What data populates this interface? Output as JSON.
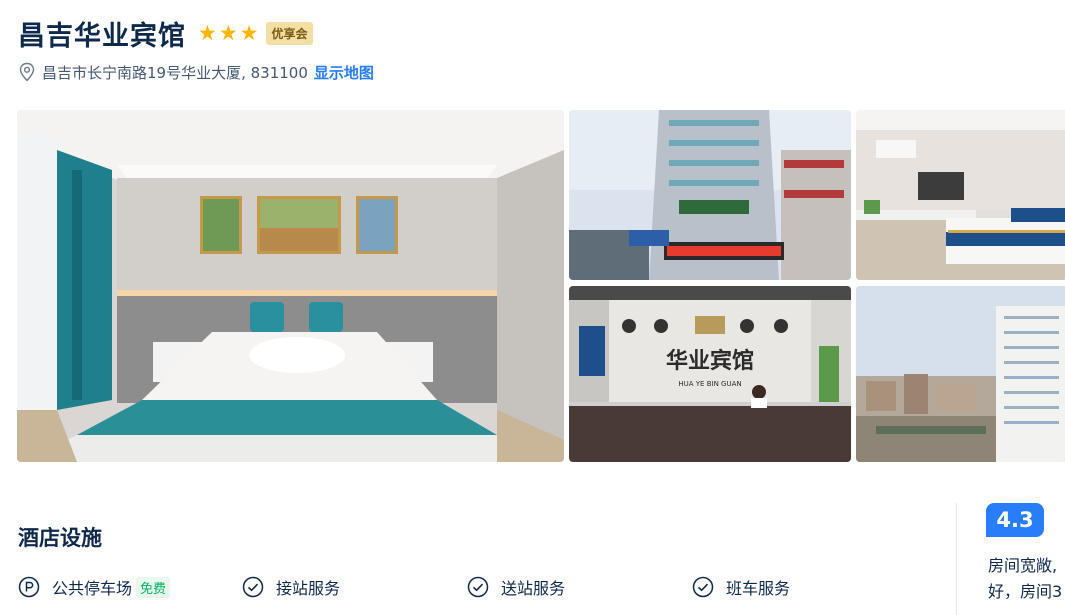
{
  "hotel": {
    "name": "昌吉华业宾馆",
    "star_count": 3,
    "badge": "优享会",
    "address": "昌吉市长宁南路19号华业大厦, 831100",
    "map_link": "显示地图"
  },
  "gallery": {
    "lobby_sign": "华业宾馆",
    "lobby_sign_pinyin": "HUA YE BIN GUAN"
  },
  "facilities": {
    "title": "酒店设施",
    "items": [
      {
        "label": "公共停车场",
        "tag": "免费",
        "icon": "parking-icon"
      },
      {
        "label": "接站服务",
        "tag": "",
        "icon": "check-circle-icon"
      },
      {
        "label": "送站服务",
        "tag": "",
        "icon": "check-circle-icon"
      },
      {
        "label": "班车服务",
        "tag": "",
        "icon": "check-circle-icon"
      }
    ]
  },
  "rating": {
    "score": "4.3",
    "review_line1": "房间宽敞,",
    "review_line2": "好，房间3"
  },
  "colors": {
    "accent": "#287dfa",
    "star": "#ffb400",
    "free": "#06ae61",
    "text": "#0f294d"
  }
}
